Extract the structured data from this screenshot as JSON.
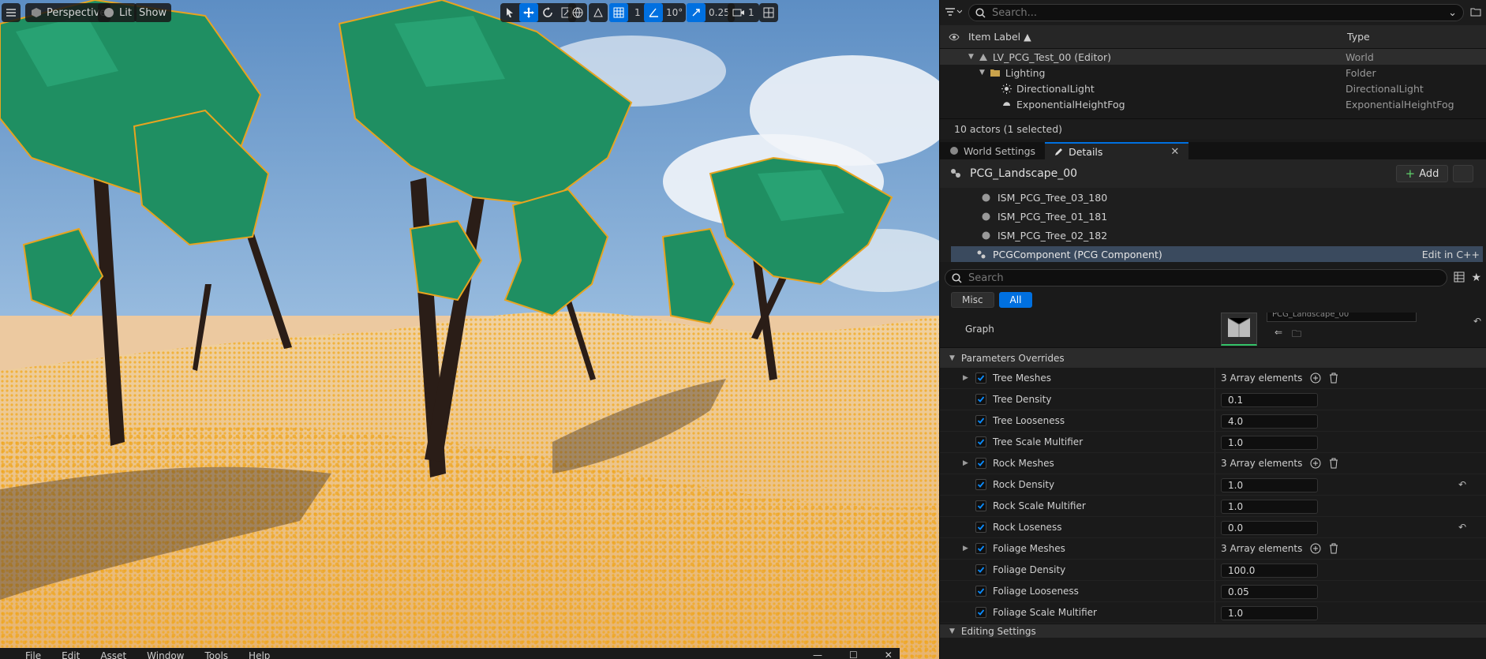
{
  "viewport": {
    "perspective_label": "Perspective",
    "lit_label": "Lit",
    "show_label": "Show",
    "grid_value": "1",
    "angle_value": "10°",
    "scale_value": "0.25",
    "camera_value": "1"
  },
  "menubar": {
    "items": [
      "File",
      "Edit",
      "Asset",
      "Window",
      "Tools",
      "Help"
    ]
  },
  "outliner": {
    "search_placeholder": "Search...",
    "col_label": "Item Label ▲",
    "col_type": "Type",
    "rows": [
      {
        "label": "LV_PCG_Test_00 (Editor)",
        "type": "World"
      },
      {
        "label": "Lighting",
        "type": "Folder"
      },
      {
        "label": "DirectionalLight",
        "type": "DirectionalLight"
      },
      {
        "label": "ExponentialHeightFog",
        "type": "ExponentialHeightFog"
      }
    ],
    "footer": "10 actors (1 selected)"
  },
  "tabs": {
    "world_settings": "World Settings",
    "details": "Details"
  },
  "details": {
    "actor_name": "PCG_Landscape_00",
    "add_label": "Add",
    "components": [
      "ISM_PCG_Tree_03_180",
      "ISM_PCG_Tree_01_181",
      "ISM_PCG_Tree_02_182"
    ],
    "selected_component": "PCGComponent (PCG Component)",
    "edit_in_cpp": "Edit in C++",
    "search_placeholder": "Search",
    "filter_misc": "Misc",
    "filter_all": "All",
    "graph_label": "Graph",
    "graph_asset": "PCG_Landscape_00",
    "section_params": "Parameters Overrides",
    "section_editing": "Editing Settings",
    "params": [
      {
        "name": "Tree Meshes",
        "value": "3 Array elements",
        "array": true
      },
      {
        "name": "Tree Density",
        "value": "0.1"
      },
      {
        "name": "Tree Looseness",
        "value": "4.0"
      },
      {
        "name": "Tree Scale Multifier",
        "value": "1.0"
      },
      {
        "name": "Rock Meshes",
        "value": "3 Array elements",
        "array": true
      },
      {
        "name": "Rock Density",
        "value": "1.0",
        "reset": true
      },
      {
        "name": "Rock Scale Multifier",
        "value": "1.0"
      },
      {
        "name": "Rock Loseness",
        "value": "0.0",
        "reset": true
      },
      {
        "name": "Foliage Meshes",
        "value": "3 Array elements",
        "array": true
      },
      {
        "name": "Foliage Density",
        "value": "100.0"
      },
      {
        "name": "Foliage Looseness",
        "value": "0.05"
      },
      {
        "name": "Foliage Scale Multifier",
        "value": "1.0"
      }
    ]
  },
  "colors": {
    "accent": "#0070e0",
    "panel": "#1a1a1a",
    "sand": "#e8b964",
    "foliage": "#1f8f62",
    "sky": "#6e9fd0"
  }
}
